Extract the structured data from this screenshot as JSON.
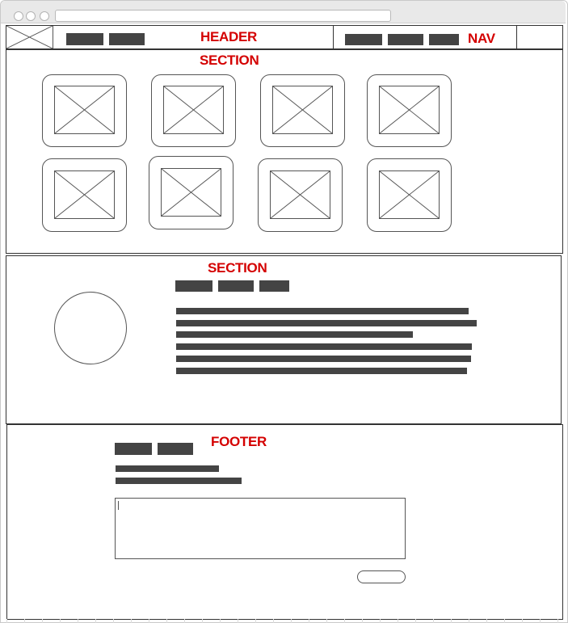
{
  "labels": {
    "header": "HEADER",
    "nav": "NAV",
    "section_gallery": "SECTION",
    "section_profile": "SECTION",
    "footer": "FOOTER"
  },
  "icons": {
    "window_controls": "traffic-light-dots",
    "placeholder": "crossed-box-image-placeholder",
    "avatar": "circle-placeholder"
  },
  "colors": {
    "annotation": "#d40000",
    "blocks": "#444444",
    "outline": "#333333"
  }
}
